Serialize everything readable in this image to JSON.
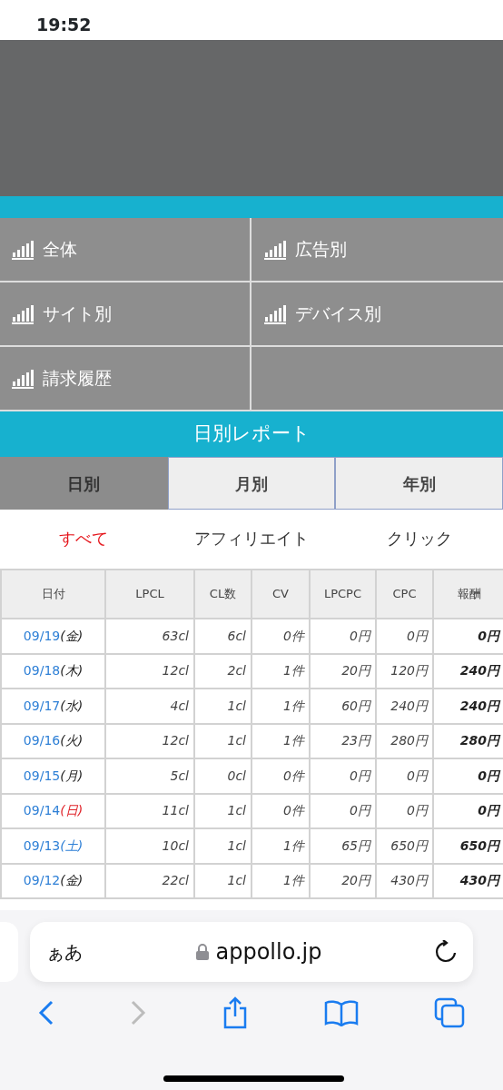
{
  "status_bar": {
    "time": "19:52"
  },
  "menu": {
    "items": [
      {
        "label": "全体"
      },
      {
        "label": "広告別"
      },
      {
        "label": "サイト別"
      },
      {
        "label": "デバイス別"
      },
      {
        "label": "請求履歴"
      }
    ]
  },
  "report_title": "日別レポート",
  "period_tabs": [
    {
      "label": "日別",
      "selected": true
    },
    {
      "label": "月別",
      "selected": false
    },
    {
      "label": "年別",
      "selected": false
    }
  ],
  "filters": [
    {
      "label": "すべて",
      "selected": true
    },
    {
      "label": "アフィリエイト",
      "selected": false
    },
    {
      "label": "クリック",
      "selected": false
    }
  ],
  "table": {
    "columns": [
      "日付",
      "LPCL",
      "CL数",
      "CV",
      "LPCPC",
      "CPC",
      "報酬"
    ],
    "rows": [
      {
        "cells": [
          {
            "date": "09/19",
            "weekday": "(金)",
            "color": "#222222"
          },
          "63cl",
          "6cl",
          "0件",
          "0円",
          "0円",
          "0円"
        ]
      },
      {
        "cells": [
          {
            "date": "09/18",
            "weekday": "(木)",
            "color": "#222222"
          },
          "12cl",
          "2cl",
          "1件",
          "20円",
          "120円",
          "240円"
        ]
      },
      {
        "cells": [
          {
            "date": "09/17",
            "weekday": "(水)",
            "color": "#222222"
          },
          "4cl",
          "1cl",
          "1件",
          "60円",
          "240円",
          "240円"
        ]
      },
      {
        "cells": [
          {
            "date": "09/16",
            "weekday": "(火)",
            "color": "#222222"
          },
          "12cl",
          "1cl",
          "1件",
          "23円",
          "280円",
          "280円"
        ]
      },
      {
        "cells": [
          {
            "date": "09/15",
            "weekday": "(月)",
            "color": "#222222"
          },
          "5cl",
          "0cl",
          "0件",
          "0円",
          "0円",
          "0円"
        ]
      },
      {
        "cells": [
          {
            "date": "09/14",
            "weekday": "(日)",
            "color": "#e0242a"
          },
          "11cl",
          "1cl",
          "0件",
          "0円",
          "0円",
          "0円"
        ]
      },
      {
        "cells": [
          {
            "date": "09/13",
            "weekday": "(土)",
            "color": "#2d7fd6"
          },
          "10cl",
          "1cl",
          "1件",
          "65円",
          "650円",
          "650円"
        ]
      },
      {
        "cells": [
          {
            "date": "09/12",
            "weekday": "(金)",
            "color": "#222222"
          },
          "22cl",
          "1cl",
          "1件",
          "20円",
          "430円",
          "430円"
        ]
      }
    ]
  },
  "browser": {
    "text_size": "ぁあ",
    "url": "appollo.jp"
  }
}
